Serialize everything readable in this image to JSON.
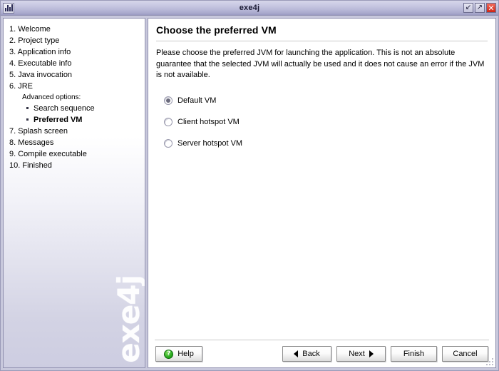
{
  "window": {
    "title": "exe4j",
    "icon": "app-chart-icon",
    "controls": [
      {
        "name": "minimize",
        "glyph": "↙"
      },
      {
        "name": "maximize",
        "glyph": "↗"
      },
      {
        "name": "close",
        "glyph": "✕"
      }
    ]
  },
  "sidebar": {
    "watermark": "exe4j",
    "steps": [
      {
        "label": "1. Welcome",
        "type": "step",
        "current": false
      },
      {
        "label": "2. Project type",
        "type": "step",
        "current": false
      },
      {
        "label": "3. Application info",
        "type": "step",
        "current": false
      },
      {
        "label": "4. Executable info",
        "type": "step",
        "current": false
      },
      {
        "label": "5. Java invocation",
        "type": "step",
        "current": false
      },
      {
        "label": "6. JRE",
        "type": "step",
        "current": false
      },
      {
        "label": "Advanced options:",
        "type": "sub-header",
        "current": false
      },
      {
        "label": "Search sequence",
        "type": "sub",
        "current": false
      },
      {
        "label": "Preferred VM",
        "type": "sub",
        "current": true
      },
      {
        "label": "7. Splash screen",
        "type": "step",
        "current": false
      },
      {
        "label": "8. Messages",
        "type": "step",
        "current": false
      },
      {
        "label": "9. Compile executable",
        "type": "step",
        "current": false
      },
      {
        "label": "10. Finished",
        "type": "step",
        "current": false
      }
    ]
  },
  "main": {
    "title": "Choose the preferred VM",
    "description": "Please choose the preferred JVM for launching the application. This is not an absolute guarantee that the selected JVM will actually be used and it does not cause an error if the JVM is not available.",
    "vm_options": [
      {
        "label": "Default VM",
        "selected": true
      },
      {
        "label": "Client hotspot VM",
        "selected": false
      },
      {
        "label": "Server hotspot VM",
        "selected": false
      }
    ]
  },
  "buttons": {
    "help": "Help",
    "back": "Back",
    "next": "Next",
    "finish": "Finish",
    "cancel": "Cancel",
    "help_icon_glyph": "?"
  },
  "colors": {
    "titlebar_top": "#d6d6ea",
    "titlebar_bottom": "#9a9ac2",
    "frame": "#c8c8dc",
    "close_button": "#cf2414",
    "help_icon_green": "#2faf23",
    "sidebar_bottom": "#cdcde1",
    "radio_dot": "#6b6b7d"
  }
}
